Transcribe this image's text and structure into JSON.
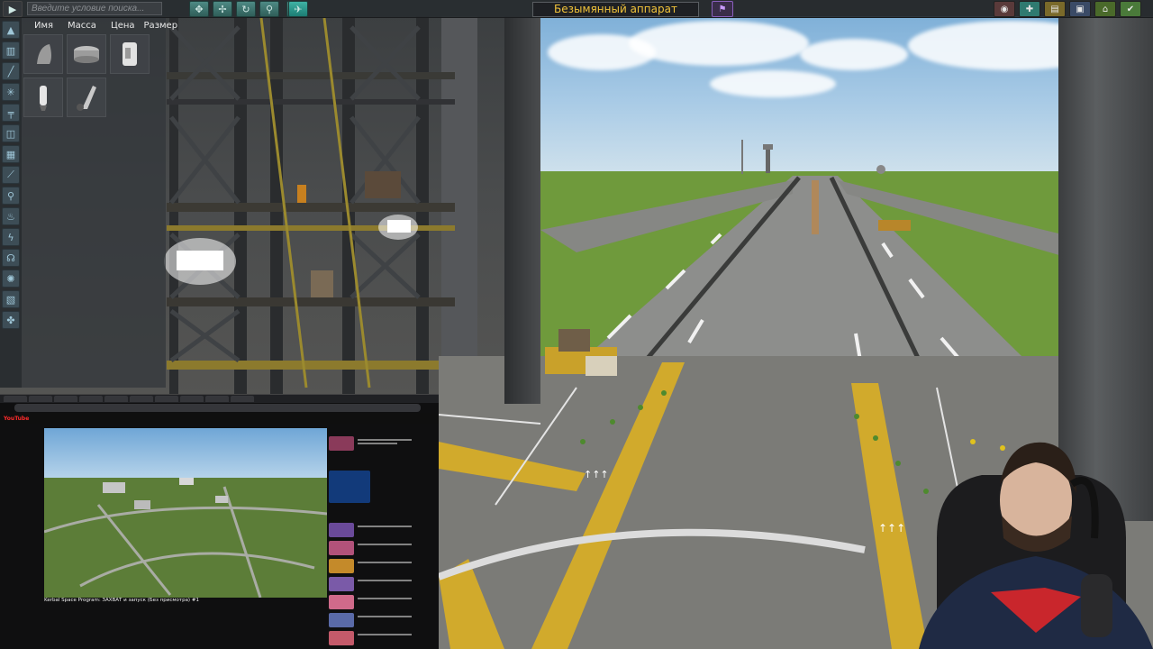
{
  "toolbar": {
    "search_placeholder": "Введите условие поиска...",
    "vessel_name": "Безымянный аппарат"
  },
  "parts_panel": {
    "columns": [
      {
        "label": "Имя"
      },
      {
        "label": "Масса"
      },
      {
        "label": "Цена"
      },
      {
        "label": "Размер"
      }
    ],
    "categories": [
      "pod-icon",
      "fuel-tank-icon",
      "engine-icon",
      "control-icon",
      "structural-icon",
      "coupling-icon",
      "payload-icon",
      "aero-icon",
      "ground-icon",
      "thermal-icon",
      "electrical-icon",
      "communication-icon",
      "science-icon",
      "cargo-icon",
      "utility-icon"
    ],
    "parts": [
      "nose-cone",
      "adapter",
      "fuel-tank",
      "separatron",
      "parachute"
    ]
  },
  "colors": {
    "accent_teal": "#2f8a80",
    "vessel_name_text": "#f1c33a",
    "flag_purple": "#8a5fbd"
  },
  "browser": {
    "site": "YouTube",
    "video_title": "Kerbal Space Program: ЗАХВАТ и запуск (Без присмотра) #1"
  }
}
